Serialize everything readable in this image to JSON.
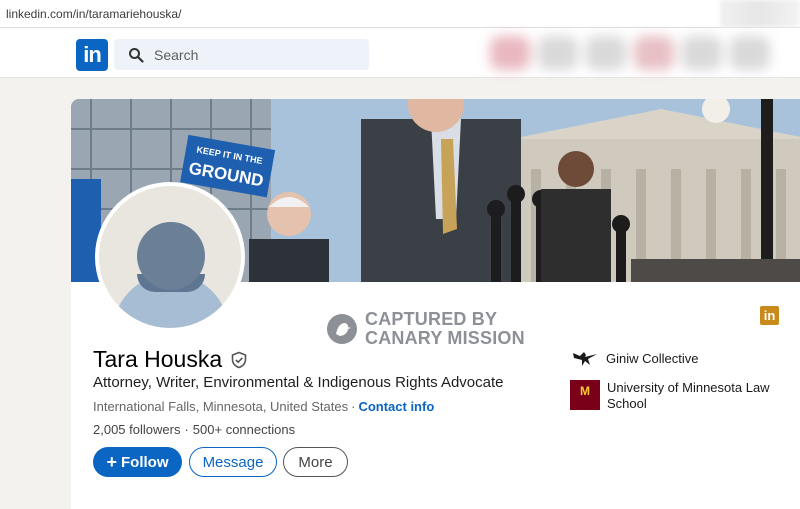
{
  "browser": {
    "url": "linkedin.com/in/taramariehouska/"
  },
  "nav": {
    "logo_text": "in",
    "search_placeholder": "Search"
  },
  "watermark": {
    "line1": "CAPTURED BY",
    "line2": "CANARY MISSION"
  },
  "profile": {
    "name": "Tara Houska",
    "headline": "Attorney, Writer, Environmental & Indigenous Rights Advocate",
    "location": "International Falls, Minnesota, United States",
    "location_separator": "·",
    "contact_info": "Contact info",
    "followers": "2,005 followers",
    "connections_separator": "·",
    "connections": "500+ connections"
  },
  "actions": {
    "follow": "Follow",
    "message": "Message",
    "more": "More"
  },
  "organizations": [
    {
      "name": "Giniw Collective"
    },
    {
      "name": "University of Minnesota Law School"
    }
  ],
  "badge_text": "in",
  "banner": {
    "sign_text_1": "KEEP IT IN THE",
    "sign_text_2": "GROUND"
  },
  "colors": {
    "brand": "#0a66c2",
    "page_bg": "#f4f2ee",
    "umn_maroon": "#7a0019"
  }
}
